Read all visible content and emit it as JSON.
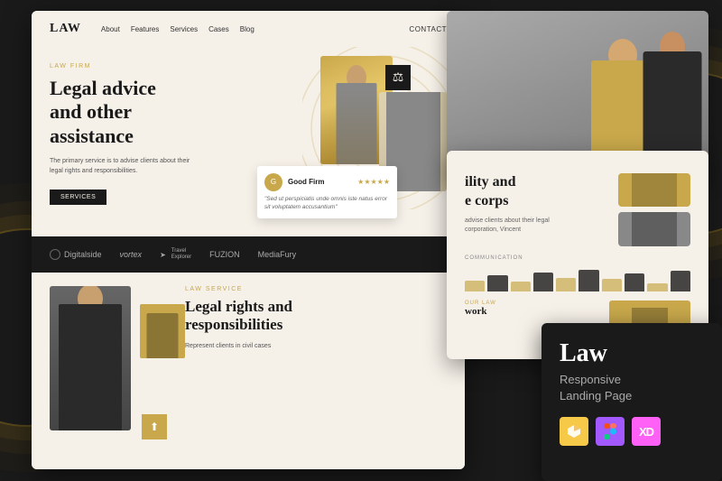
{
  "app": {
    "title": "Law - Responsive Landing Page"
  },
  "nav": {
    "logo": "LAW",
    "links": [
      "About",
      "Features",
      "Services",
      "Cases",
      "Blog"
    ],
    "contact": "CONTACT"
  },
  "hero": {
    "tag": "LAW FIRM",
    "title": "Legal advice\nand other\nassistance",
    "description": "The primary service is to advise clients about their legal rights and responsibilities.",
    "button": "SERVICES"
  },
  "review": {
    "company": "Good Firm",
    "stars": "★★★★★",
    "text": "\"Sed ut perspiciatis unde omnis iste natus error sit voluptatem accusantium\""
  },
  "partners": [
    {
      "icon": "circle",
      "name": "Digitalside"
    },
    {
      "icon": "vortex",
      "name": "Vortex"
    },
    {
      "icon": "arrow",
      "name": "Travel Explorer"
    },
    {
      "icon": "none",
      "name": "FUZION"
    },
    {
      "icon": "none",
      "name": "MediaFury"
    }
  ],
  "bottom": {
    "tag": "LAW SERVICE",
    "title": "Legal rights and\nresponsibilities",
    "description": "Represent clients in civil cases"
  },
  "right_panel": {
    "section1": {
      "title": "ility and\ne corps",
      "text": "advise clients about their legal\ncorporation, Vincent"
    },
    "section2": {
      "tag": "Communication",
      "bars": [
        40,
        60,
        35,
        70,
        50,
        80,
        45,
        65,
        30,
        75
      ]
    },
    "section3": {
      "subtitle_label": "our law\nwork"
    }
  },
  "dark_panel": {
    "title": "Law",
    "subtitle_line1": "Responsive",
    "subtitle_line2": "Landing Page",
    "tools": [
      {
        "name": "Sketch",
        "symbol": "⬡"
      },
      {
        "name": "Figma",
        "symbol": "✦"
      },
      {
        "name": "XD",
        "symbol": "XD"
      }
    ]
  }
}
